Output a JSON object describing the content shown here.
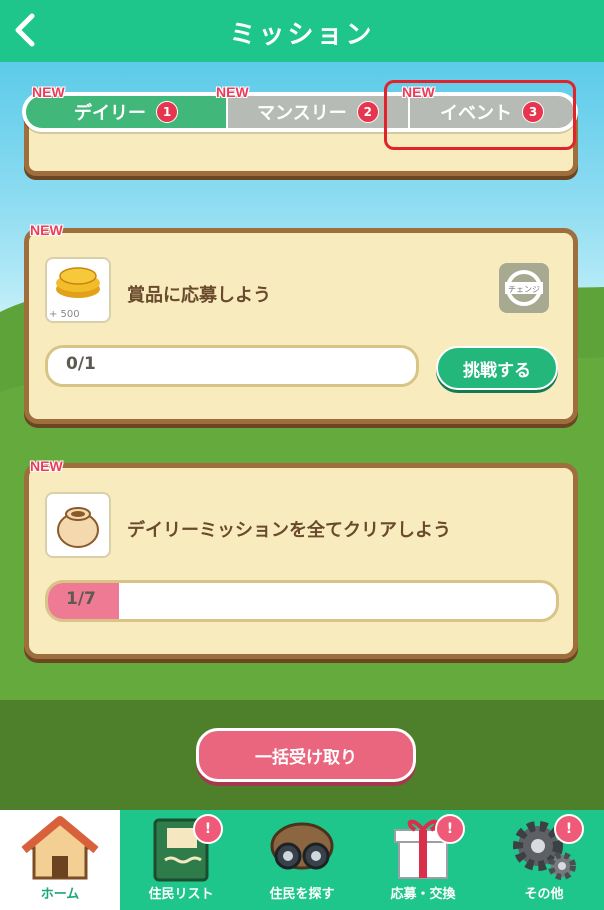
{
  "header": {
    "title": "ミッション"
  },
  "tabs": [
    {
      "label": "デイリー",
      "count": "1",
      "new": "NEW"
    },
    {
      "label": "マンスリー",
      "count": "2",
      "new": "NEW"
    },
    {
      "label": "イベント",
      "count": "3",
      "new": "NEW"
    }
  ],
  "missions": [
    {
      "new": "NEW",
      "title": "賞品に応募しよう",
      "reward": "+ 500",
      "progress": "0/1",
      "progress_fraction": 0,
      "action": "挑戦する",
      "change_label": "チェンジ"
    },
    {
      "new": "NEW",
      "title": "デイリーミッションを全てクリアしよう",
      "progress": "1/7",
      "progress_fraction": 0.14
    }
  ],
  "receive_all": "一括受け取り",
  "nav": [
    {
      "label": "ホーム",
      "icon": "house-icon",
      "badge": ""
    },
    {
      "label": "住民リスト",
      "icon": "notebook-icon",
      "badge": "!"
    },
    {
      "label": "住民を探す",
      "icon": "binoculars-icon",
      "badge": ""
    },
    {
      "label": "応募・交換",
      "icon": "gift-icon",
      "badge": "!"
    },
    {
      "label": "その他",
      "icon": "gear-icon",
      "badge": "!"
    }
  ],
  "colors": {
    "primary": "#1fc68c",
    "card_bg": "#f8ecbf",
    "card_border": "#9e6e3c",
    "accent_pink": "#e9667e",
    "badge_red": "#e6364f"
  }
}
